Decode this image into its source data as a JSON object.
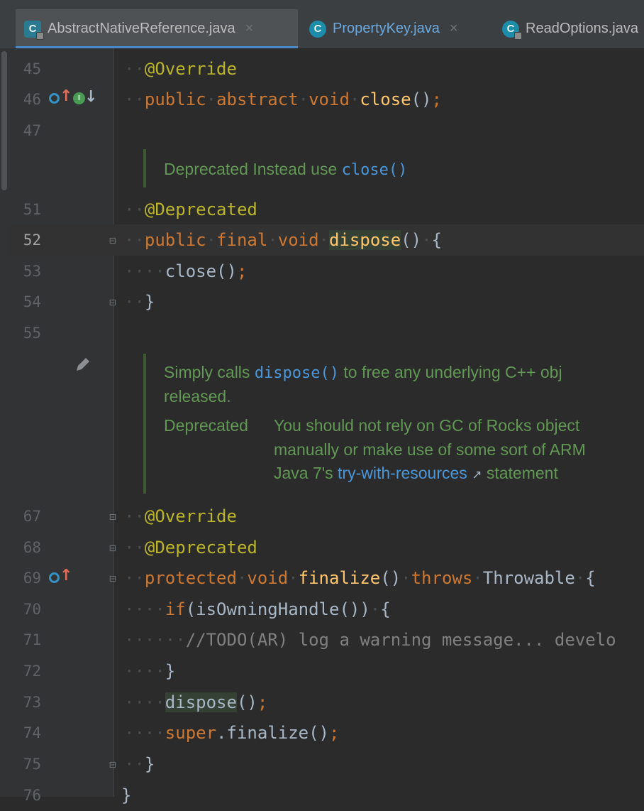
{
  "tabs": [
    {
      "label": "AbstractNativeReference.java",
      "icon": "abstract-class-icon",
      "close": "×"
    },
    {
      "label": "PropertyKey.java",
      "icon": "class-icon",
      "close": "×"
    },
    {
      "label": "ReadOptions.java",
      "icon": "class-icon"
    }
  ],
  "lines": {
    "l45": "45",
    "l46": "46",
    "l47": "47",
    "l51": "51",
    "l52": "52",
    "l53": "53",
    "l54": "54",
    "l55": "55",
    "l67": "67",
    "l68": "68",
    "l69": "69",
    "l70": "70",
    "l71": "71",
    "l72": "72",
    "l73": "73",
    "l74": "74",
    "l75": "75",
    "l76": "76"
  },
  "code": {
    "override": "@Override",
    "public": "public",
    "abstract": "abstract",
    "void": "void",
    "close": "close",
    "parens": "()",
    "semi": ";",
    "deprecated": "@Deprecated",
    "final": "final",
    "dispose": "dispose",
    "brace_open": "{",
    "brace_close": "}",
    "protected": "protected",
    "finalize": "finalize",
    "throws": "throws",
    "throwable": "Throwable",
    "if": "if",
    "is_owning": "(isOwningHandle())",
    "todo_comment": "//TODO(AR) log a warning message... develo",
    "super": "super",
    "super_finalize": ".finalize()",
    "class_close": "}"
  },
  "docs": {
    "doc1_deprecated": "Deprecated",
    "doc1_instead": "Instead use",
    "doc1_link": "close()",
    "doc2_simply": "Simply calls",
    "doc2_link": "dispose()",
    "doc2_rest": "to free any underlying C++ obj",
    "doc2_released": "released.",
    "doc2_deprecated": "Deprecated",
    "doc2_line1": "You should not rely on GC of Rocks object",
    "doc2_line2": "manually or make use of some sort of ARM",
    "doc2_java": "Java 7's",
    "doc2_link2": "try-with-resources",
    "doc2_arrow": "↗",
    "doc2_statement": "statement"
  },
  "colors": {
    "background": "#2b2b2b",
    "keyword": "#cc7832",
    "annotation": "#bbb529",
    "function": "#ffc66d",
    "doc_text": "#629755",
    "link": "#4a96d9",
    "override_marker": "#3592c4",
    "implement_marker": "#499c54",
    "up_arrow": "#e06c5a"
  }
}
